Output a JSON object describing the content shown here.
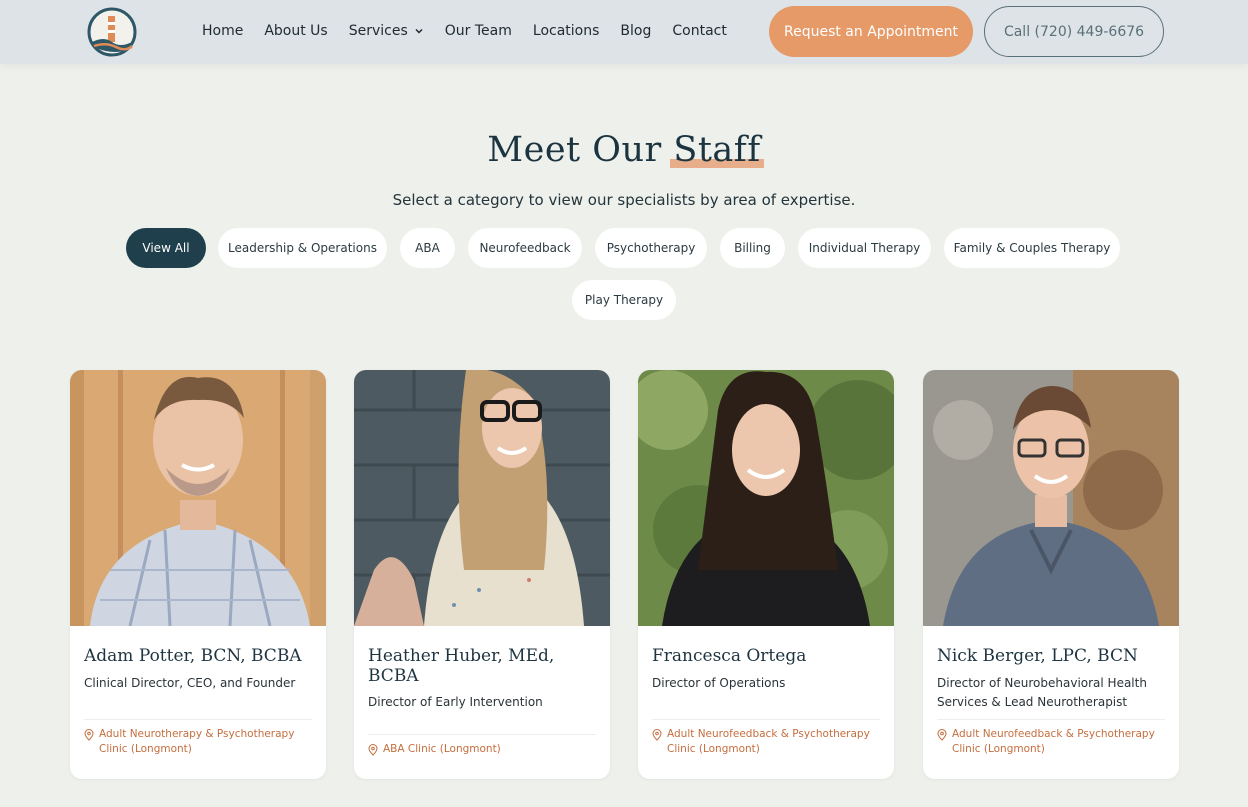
{
  "header": {
    "nav": [
      {
        "label": "Home"
      },
      {
        "label": "About Us"
      },
      {
        "label": "Services"
      },
      {
        "label": "Our Team"
      },
      {
        "label": "Locations"
      },
      {
        "label": "Blog"
      },
      {
        "label": "Contact"
      }
    ],
    "appointment_label": "Request an Appointment",
    "call_label": "Call (720) 449-6676"
  },
  "page": {
    "title_part1": "Meet Our",
    "title_part2": "Staff",
    "subtitle": "Select a category to view our specialists by area of expertise."
  },
  "filters": [
    {
      "label": "View All",
      "active": true
    },
    {
      "label": "Leadership & Operations"
    },
    {
      "label": "ABA"
    },
    {
      "label": "Neurofeedback"
    },
    {
      "label": "Psychotherapy"
    },
    {
      "label": "Billing"
    },
    {
      "label": "Individual Therapy"
    },
    {
      "label": "Family & Couples Therapy"
    },
    {
      "label": "Play Therapy"
    }
  ],
  "staff": [
    {
      "name": "Adam Potter, BCN, BCBA",
      "role": "Clinical Director, CEO, and Founder",
      "location": "Adult Neurotherapy & Psychotherapy Clinic (Longmont)"
    },
    {
      "name": "Heather Huber, MEd, BCBA",
      "role": "Director of Early Intervention",
      "location": "ABA Clinic (Longmont)"
    },
    {
      "name": "Francesca Ortega",
      "role": "Director of Operations",
      "location": "Adult Neurofeedback & Psychotherapy Clinic (Longmont)"
    },
    {
      "name": "Nick Berger, LPC, BCN",
      "role": "Director of Neurobehavioral Health Services & Lead Neurotherapist",
      "location": "Adult Neurofeedback & Psychotherapy Clinic (Longmont)"
    }
  ],
  "colors": {
    "accent": "#e59a68",
    "dark": "#1f3f4c",
    "location": "#c46e3e",
    "background": "#eef0ec"
  },
  "icons": [
    "lighthouse-logo",
    "chevron-down-icon",
    "location-pin-icon"
  ]
}
